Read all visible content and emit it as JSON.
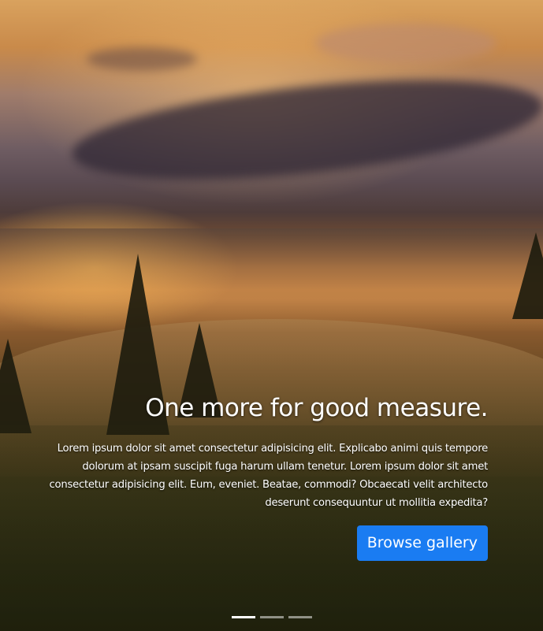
{
  "slide": {
    "heading": "One more for good measure.",
    "body": "Lorem ipsum dolor sit amet consectetur adipisicing elit. Explicabo animi quis tempore dolorum at ipsam suscipit fuga harum ullam tenetur. Lorem ipsum dolor sit amet consectetur adipisicing elit. Eum, eveniet. Beatae, commodi? Obcaecati velit architecto deserunt consequuntur ut mollitia expedita?",
    "button_label": "Browse gallery",
    "button_color": "#1a7cf2"
  },
  "carousel": {
    "indicators": [
      {
        "active": true
      },
      {
        "active": false
      },
      {
        "active": false
      }
    ]
  }
}
